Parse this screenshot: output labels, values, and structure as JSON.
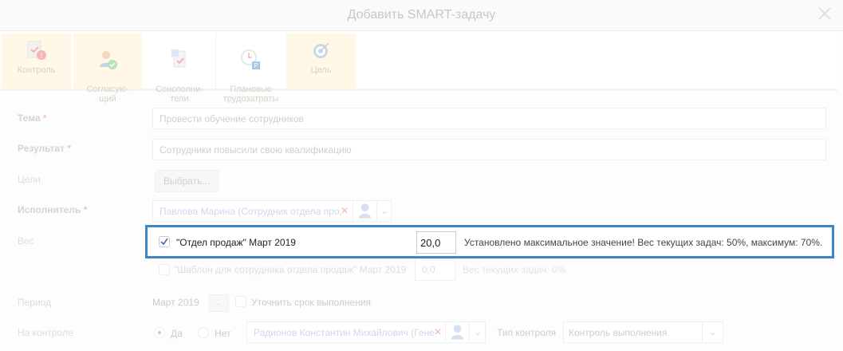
{
  "dialog": {
    "title": "Добавить SMART-задачу"
  },
  "toolbar": [
    {
      "label": "Контроль",
      "icon": "clipboard-alert-icon"
    },
    {
      "label": "Согласую-\nщий",
      "icon": "user-check-icon"
    },
    {
      "label": "Соисполни-\nтели",
      "icon": "coexecutors-icon"
    },
    {
      "label": "Плановые\nтрудозатраты",
      "icon": "clock-p-icon"
    },
    {
      "label": "Цель",
      "icon": "target-icon"
    }
  ],
  "form": {
    "topic": {
      "label": "Тема",
      "value": "Провести обучение сотрудников"
    },
    "result": {
      "label": "Результат",
      "value": "Сотрудники повысили свою квалификацию"
    },
    "goals": {
      "label": "Цели",
      "button": "Выбрать..."
    },
    "executor": {
      "label": "Исполнитель",
      "value": "Павлова Марина (Сотрудник отдела про,"
    },
    "required_mark": "*",
    "weight": {
      "label": "Вес",
      "rows": [
        {
          "name": "\"Отдел продаж\" Март 2019",
          "value": "20,0",
          "note": "Установлено максимальное значение! Вес текущих задач: 50%, максимум: 70%.",
          "checked": true
        },
        {
          "name": "\"Шаблон для сотрудника отдела продаж\" Март 2019",
          "value": "0,0",
          "note": "Вес текущих задач: 0%",
          "checked": false
        }
      ]
    },
    "period": {
      "label": "Период",
      "value": "Март 2019",
      "button": "...",
      "refine_label": "Уточнить срок выполнения"
    },
    "control": {
      "label": "На контроле",
      "yes": "Да",
      "no": "Нет",
      "controller": "Радионов Константин Михайлович (Гене",
      "type_label": "Тип контроля",
      "type_value": "Контроль выполнения"
    }
  },
  "colors": {
    "highlight": "#3c86c7"
  }
}
